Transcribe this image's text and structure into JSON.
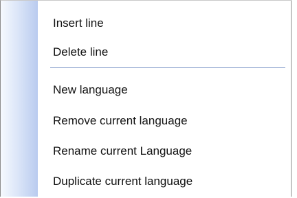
{
  "context_menu": {
    "items": [
      {
        "label": "Insert line"
      },
      {
        "label": "Delete line"
      },
      {
        "label": "New language"
      },
      {
        "label": "Remove current language"
      },
      {
        "label": "Rename current Language"
      },
      {
        "label": "Duplicate current language"
      }
    ]
  }
}
